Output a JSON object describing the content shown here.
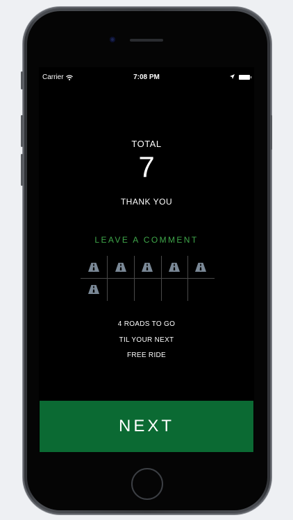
{
  "status_bar": {
    "carrier": "Carrier",
    "time": "7:08 PM",
    "icons": [
      "wifi-icon",
      "location-arrow-icon",
      "battery-icon"
    ]
  },
  "summary": {
    "total_label": "TOTAL",
    "total_value": "7",
    "thank_you": "THANK YOU"
  },
  "comment_link": "LEAVE A COMMENT",
  "road_card": {
    "icon": "road-icon",
    "filled": 6,
    "total": 10
  },
  "progress": {
    "line1": "4 ROADS TO GO",
    "line2": "TIL YOUR NEXT",
    "line3": "FREE RIDE"
  },
  "next_button": "NEXT",
  "colors": {
    "accent_green": "#3fa64a",
    "button_green": "#0b6a33",
    "road_icon": "#7a8896",
    "screen_bg": "#000000"
  }
}
